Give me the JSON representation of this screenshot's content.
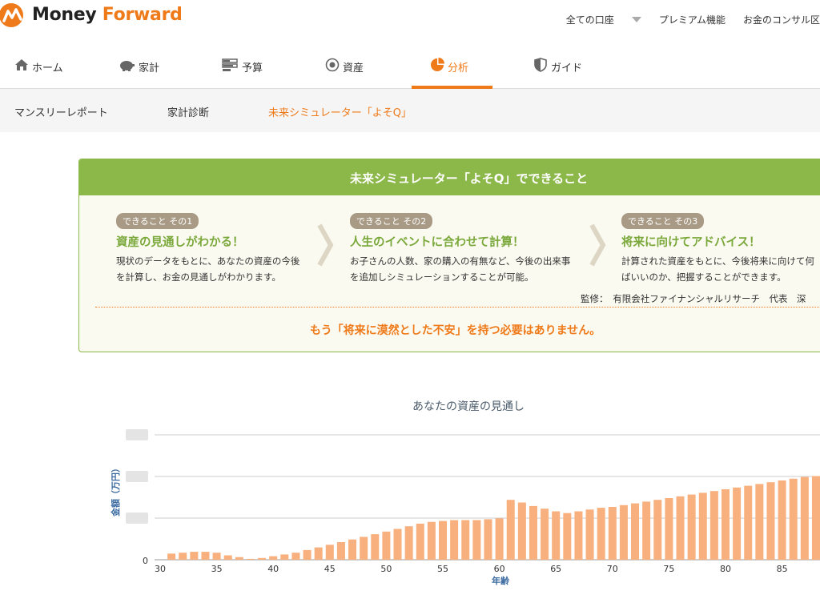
{
  "header": {
    "logo_money": "Money",
    "logo_forward": "Forward",
    "links": [
      "全ての口座",
      "プレミアム機能",
      "お金のコンサル区"
    ]
  },
  "mainnav": {
    "tabs": [
      {
        "label": "ホーム",
        "icon": "home-icon"
      },
      {
        "label": "家計",
        "icon": "piggy-bank-icon"
      },
      {
        "label": "予算",
        "icon": "budget-icon"
      },
      {
        "label": "資産",
        "icon": "assets-gear-icon"
      },
      {
        "label": "分析",
        "icon": "pie-chart-icon",
        "active": true
      },
      {
        "label": "ガイド",
        "icon": "shield-icon"
      }
    ]
  },
  "subnav": {
    "items": [
      "マンスリーレポート",
      "家計診断",
      "未来シミュレーター「よそQ」"
    ],
    "active_index": 2
  },
  "infobox": {
    "title": "未来シミュレーター「よそQ」でできること",
    "features": [
      {
        "badge": "できること その1",
        "title": "資産の見通しがわかる！",
        "desc": [
          "現状のデータをもとに、あなたの資産の今後",
          "を計算し、お金の見通しがわかります。"
        ]
      },
      {
        "badge": "できること その2",
        "title": "人生のイベントに合わせて計算！",
        "desc": [
          "お子さんの人数、家の購入の有無など、今後の出来事",
          "を追加しシミュレーションすることが可能。"
        ]
      },
      {
        "badge": "できること その3",
        "title": "将来に向けてアドバイス！",
        "desc": [
          "計算された資産をもとに、今後将来に向けて何",
          "ばいいのか、把握することができます。"
        ]
      }
    ],
    "supervise": "監修：　有限会社ファイナンシャルリサーチ　代表　深",
    "tagline": "もう「将来に漠然とした不安」を持つ必要はありません。"
  },
  "chart_data": {
    "type": "bar",
    "title": "あなたの資産の見通し",
    "xlabel": "年齢",
    "ylabel": "金額（万円）",
    "x_ticks": [
      30,
      35,
      40,
      45,
      50,
      55,
      60,
      65,
      70,
      75,
      80,
      85
    ],
    "y_tick_labels": [
      "0"
    ],
    "bar_color": "#f7b07e",
    "x": [
      31,
      32,
      33,
      34,
      35,
      36,
      37,
      38,
      39,
      40,
      41,
      42,
      43,
      44,
      45,
      46,
      47,
      48,
      49,
      50,
      51,
      52,
      53,
      54,
      55,
      56,
      57,
      58,
      59,
      60,
      61,
      62,
      63,
      64,
      65,
      66,
      67,
      68,
      69,
      70,
      71,
      72,
      73,
      74,
      75,
      76,
      77,
      78,
      79,
      80,
      81,
      82,
      83,
      84,
      85,
      86,
      87,
      88
    ],
    "values": [
      7,
      8,
      9,
      9,
      8,
      5,
      3,
      1,
      2,
      4,
      6,
      8,
      11,
      14,
      17,
      20,
      23,
      26,
      29,
      32,
      35,
      38,
      41,
      43,
      44,
      45,
      45,
      45,
      46,
      47,
      68,
      65,
      61,
      58,
      55,
      53,
      55,
      57,
      59,
      60,
      62,
      64,
      66,
      68,
      70,
      72,
      74,
      76,
      78,
      80,
      82,
      84,
      86,
      88,
      90,
      92,
      94,
      95
    ],
    "ylim": [
      0,
      150
    ]
  }
}
